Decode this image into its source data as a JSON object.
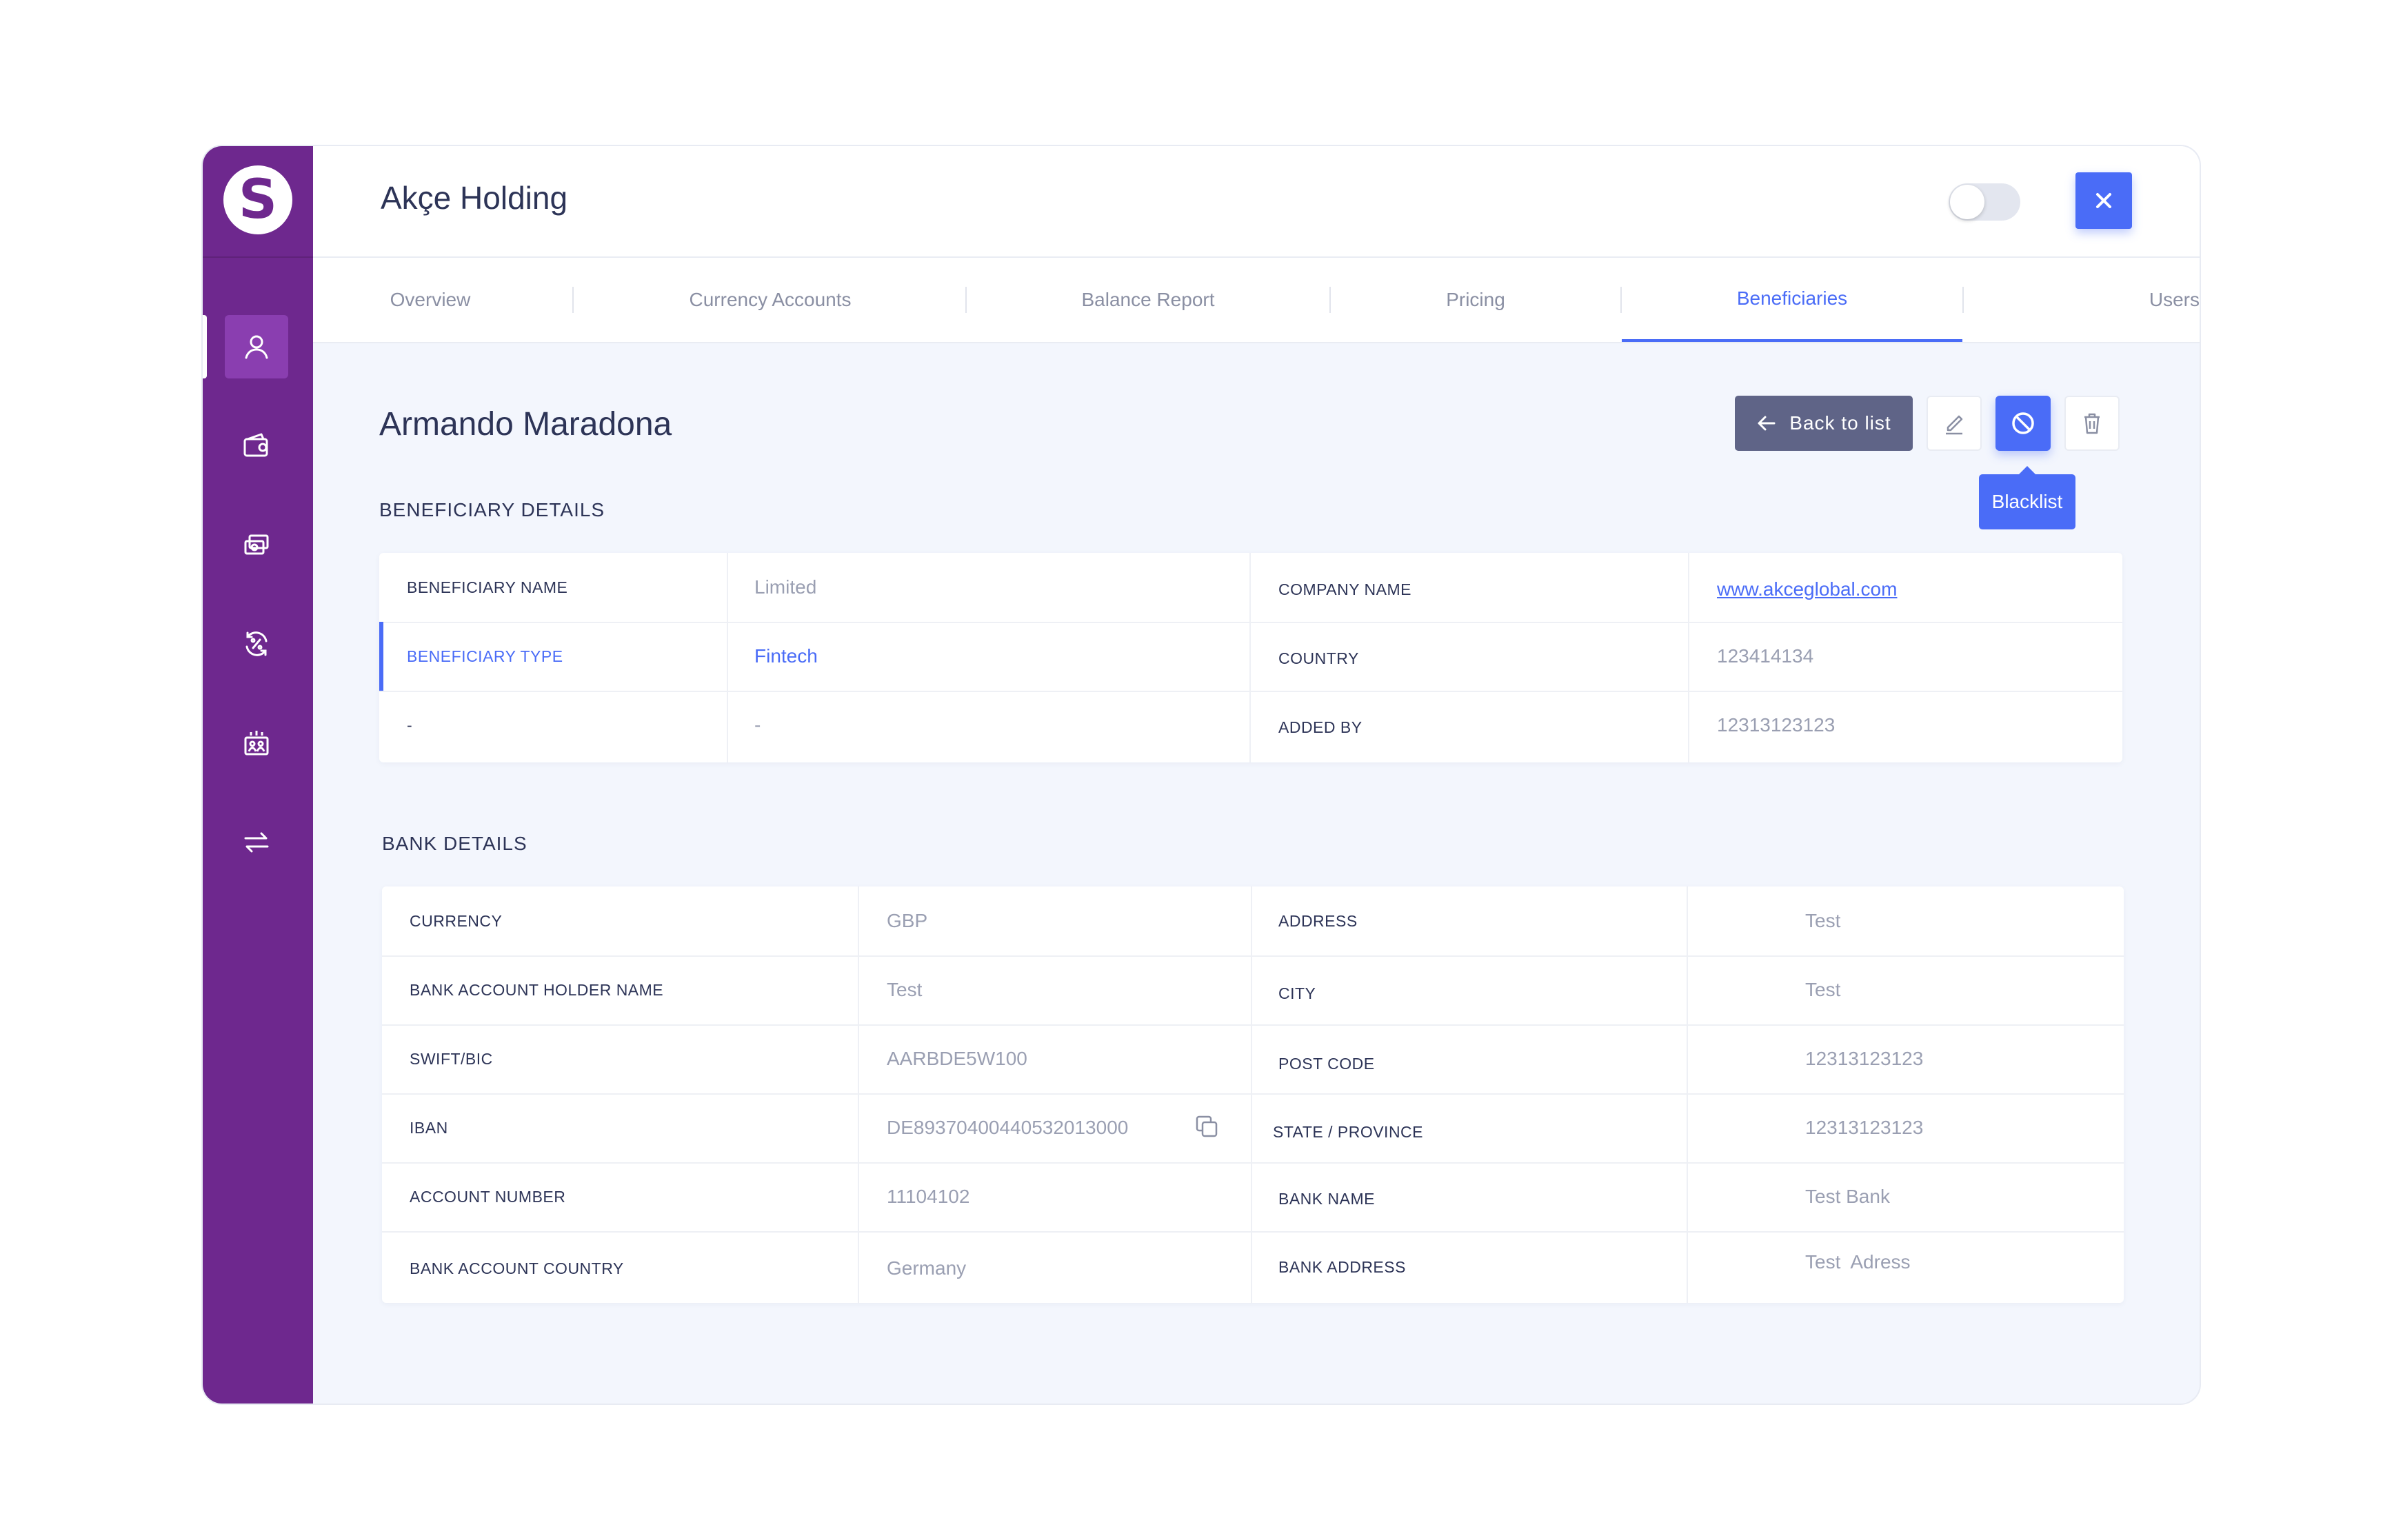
{
  "app": {
    "logo_letter": "S",
    "company_title": "Akçe Holding",
    "accent_color": "#4a6cf7",
    "sidebar_color": "#6e288e"
  },
  "sidebar": {
    "items": [
      {
        "icon": "user-icon",
        "active": true
      },
      {
        "icon": "wallet-icon",
        "active": false
      },
      {
        "icon": "cards-icon",
        "active": false
      },
      {
        "icon": "exchange-rate-icon",
        "active": false
      },
      {
        "icon": "team-icon",
        "active": false
      },
      {
        "icon": "transfer-icon",
        "active": false
      }
    ]
  },
  "tabs": [
    {
      "label": "Overview"
    },
    {
      "label": "Currency Accounts"
    },
    {
      "label": "Balance Report"
    },
    {
      "label": "Pricing"
    },
    {
      "label": "Beneficiaries"
    },
    {
      "label": "Users"
    }
  ],
  "page": {
    "person_name": "Armando Maradona",
    "back_label": "Back to list",
    "tooltip": "Blacklist"
  },
  "beneficiary": {
    "section_title": "BENEFICIARY DETAILS",
    "left": [
      {
        "label": "BENEFICIARY NAME",
        "value": "Limited"
      },
      {
        "label": "BENEFICIARY TYPE",
        "value": "Fintech"
      },
      {
        "label": "-",
        "value": "-"
      }
    ],
    "right": [
      {
        "label": "COMPANY NAME",
        "value": "www.akceglobal.com"
      },
      {
        "label": "COUNTRY",
        "value": "123414134"
      },
      {
        "label": "ADDED BY",
        "value": "12313123123"
      }
    ]
  },
  "bank": {
    "section_title": "BANK DETAILS",
    "left": [
      {
        "label": "CURRENCY",
        "value": "GBP"
      },
      {
        "label": "BANK ACCOUNT HOLDER NAME",
        "value": "Test"
      },
      {
        "label": "SWIFT/BIC",
        "value": "AARBDE5W100"
      },
      {
        "label": "IBAN",
        "value": "DE89370400440532013000"
      },
      {
        "label": "ACCOUNT NUMBER",
        "value": "11104102"
      },
      {
        "label": "BANK ACCOUNT COUNTRY",
        "value": "Germany"
      }
    ],
    "right": [
      {
        "label": "ADDRESS",
        "value": "Test"
      },
      {
        "label": "CITY",
        "value": "Test"
      },
      {
        "label": "POST CODE",
        "value": "12313123123"
      },
      {
        "label": "STATE / PROVINCE",
        "value": "12313123123"
      },
      {
        "label": "BANK NAME",
        "value": "Test Bank"
      },
      {
        "label": "BANK ADDRESS",
        "value": "Test  Adress"
      }
    ]
  }
}
